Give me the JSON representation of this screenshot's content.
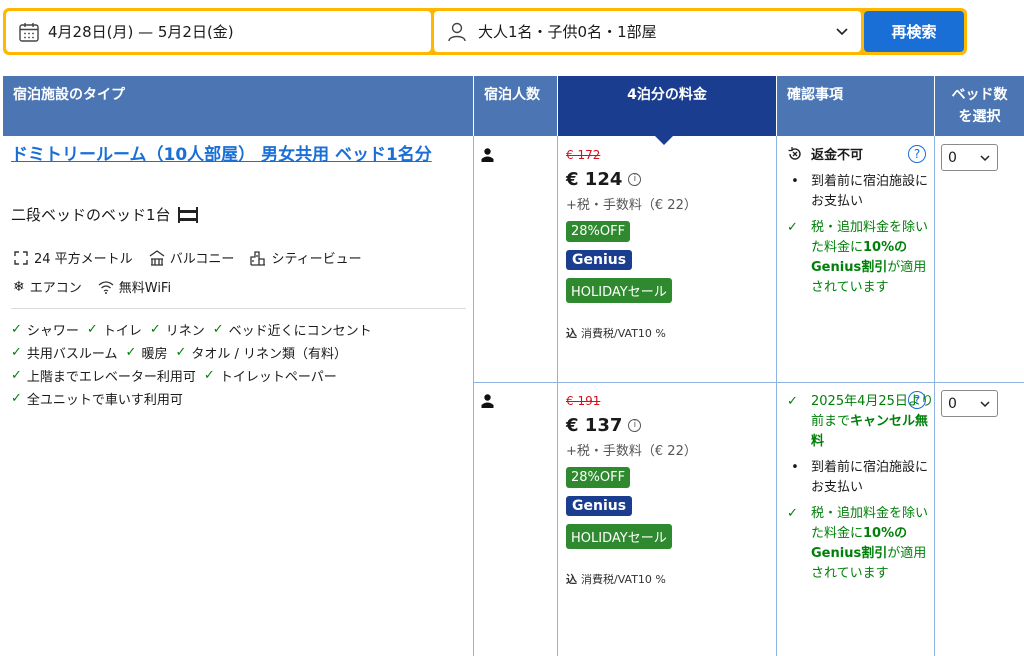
{
  "search": {
    "dates": "4月28日(月) — 5月2日(金)",
    "guests": "大人1名・子供0名・1部屋",
    "button": "再検索"
  },
  "table": {
    "headers": {
      "type": "宿泊施設のタイプ",
      "occupancy": "宿泊人数",
      "price": "4泊分の料金",
      "conditions": "確認事項",
      "select_line1": "ベッド数",
      "select_line2": "を選択"
    }
  },
  "room": {
    "name": "ドミトリールーム（10人部屋） 男女共用 ベッド1名分",
    "bed": "二段ベッドのベッド1台",
    "facilities_row1": [
      "24 平方メートル",
      "バルコニー",
      "シティービュー"
    ],
    "facilities_row2": [
      "エアコン",
      "無料WiFi"
    ],
    "amenities": [
      [
        "シャワー",
        "トイレ",
        "リネン",
        "ベッド近くにコンセント"
      ],
      [
        "共用バスルーム",
        "暖房",
        "タオル / リネン類（有料）"
      ],
      [
        "上階までエレベーター利用可",
        "トイレットペーパー"
      ],
      [
        "全ユニットで車いす利用可"
      ]
    ]
  },
  "options": [
    {
      "old_price": "€ 172",
      "price": "€ 124",
      "tax": "+税・手数料（€ 22）",
      "badge_off": "28%OFF",
      "badge_genius": "Genius",
      "badge_holiday": "HOLIDAYセール",
      "vat_icon": "込",
      "vat": "消費税/VAT10 %",
      "cond_title": "返金不可",
      "cond_pay": "到着前に宿泊施設にお支払い",
      "cond_genius_a": "税・追加料金を除いた料金に",
      "cond_genius_b": "10%のGenius割引",
      "cond_genius_c": "が適用されています",
      "select": "0"
    },
    {
      "old_price": "€ 191",
      "price": "€ 137",
      "tax": "+税・手数料（€ 22）",
      "badge_off": "28%OFF",
      "badge_genius": "Genius",
      "badge_holiday": "HOLIDAYセール",
      "vat_icon": "込",
      "vat": "消費税/VAT10 %",
      "cond_cancel_a": "2025年4月25日より前まで",
      "cond_cancel_b": "キャンセル無料",
      "cond_pay": "到着前に宿泊施設にお支払い",
      "cond_genius_a": "税・追加料金を除いた料金に",
      "cond_genius_b": "10%のGenius割引",
      "cond_genius_c": "が適用されています",
      "select": "0"
    }
  ],
  "icons": {
    "calendar": "calendar-icon",
    "person": "person-icon",
    "chevron": "chevron-down-icon",
    "bunk": "bunk-bed-icon",
    "check": "check-icon",
    "info": "info-icon",
    "no_refund": "no-refund-icon",
    "help": "help-icon"
  },
  "colors": {
    "search_border": "#ffb700",
    "button": "#1a6fd6",
    "header": "#4b76b3",
    "price_header": "#1a3d8f",
    "green": "#008009",
    "strike_red": "#d4111e"
  }
}
